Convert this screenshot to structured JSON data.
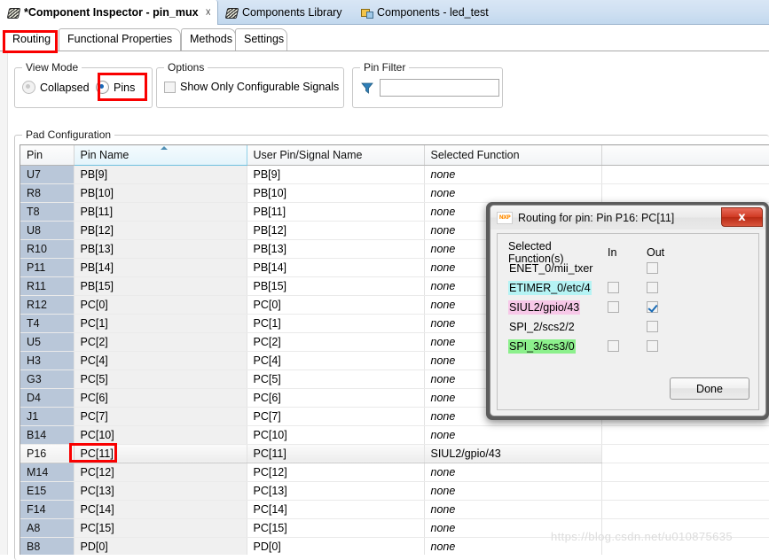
{
  "editor_tabs": [
    {
      "label": "*Component Inspector - pin_mux",
      "icon": "wedge-icon",
      "active": true,
      "closable": true
    },
    {
      "label": "Components Library",
      "icon": "wedge-icon",
      "active": false,
      "closable": false
    },
    {
      "label": "Components - led_test",
      "icon": "components-icon",
      "active": false,
      "closable": false
    }
  ],
  "inner_tabs": [
    {
      "label": "Routing",
      "selected": true
    },
    {
      "label": "Functional Properties",
      "selected": false
    },
    {
      "label": "Methods",
      "selected": false
    },
    {
      "label": "Settings",
      "selected": false
    }
  ],
  "view_mode": {
    "title": "View Mode",
    "options": [
      {
        "label": "Collapsed",
        "selected": false
      },
      {
        "label": "Pins",
        "selected": true
      }
    ]
  },
  "options": {
    "title": "Options",
    "checkbox_label": "Show Only Configurable Signals",
    "checked": false
  },
  "pin_filter": {
    "title": "Pin Filter",
    "icon": "filter-icon",
    "value": "",
    "placeholder": ""
  },
  "pad_configuration": {
    "title": "Pad Configuration",
    "columns": [
      "Pin",
      "Pin Name",
      "User Pin/Signal Name",
      "Selected Function",
      ""
    ],
    "sorted_column": "Pin Name",
    "sort_direction": "ascending",
    "rows": [
      {
        "pin": "U7",
        "pin_name": "PB[9]",
        "user": "PB[9]",
        "func": "none",
        "selected": false
      },
      {
        "pin": "R8",
        "pin_name": "PB[10]",
        "user": "PB[10]",
        "func": "none",
        "selected": false
      },
      {
        "pin": "T8",
        "pin_name": "PB[11]",
        "user": "PB[11]",
        "func": "none",
        "selected": false
      },
      {
        "pin": "U8",
        "pin_name": "PB[12]",
        "user": "PB[12]",
        "func": "none",
        "selected": false
      },
      {
        "pin": "R10",
        "pin_name": "PB[13]",
        "user": "PB[13]",
        "func": "none",
        "selected": false
      },
      {
        "pin": "P11",
        "pin_name": "PB[14]",
        "user": "PB[14]",
        "func": "none",
        "selected": false
      },
      {
        "pin": "R11",
        "pin_name": "PB[15]",
        "user": "PB[15]",
        "func": "none",
        "selected": false
      },
      {
        "pin": "R12",
        "pin_name": "PC[0]",
        "user": "PC[0]",
        "func": "none",
        "selected": false
      },
      {
        "pin": "T4",
        "pin_name": "PC[1]",
        "user": "PC[1]",
        "func": "none",
        "selected": false
      },
      {
        "pin": "U5",
        "pin_name": "PC[2]",
        "user": "PC[2]",
        "func": "none",
        "selected": false
      },
      {
        "pin": "H3",
        "pin_name": "PC[4]",
        "user": "PC[4]",
        "func": "none",
        "selected": false
      },
      {
        "pin": "G3",
        "pin_name": "PC[5]",
        "user": "PC[5]",
        "func": "none",
        "selected": false
      },
      {
        "pin": "D4",
        "pin_name": "PC[6]",
        "user": "PC[6]",
        "func": "none",
        "selected": false
      },
      {
        "pin": "J1",
        "pin_name": "PC[7]",
        "user": "PC[7]",
        "func": "none",
        "selected": false
      },
      {
        "pin": "B14",
        "pin_name": "PC[10]",
        "user": "PC[10]",
        "func": "none",
        "selected": false
      },
      {
        "pin": "P16",
        "pin_name": "PC[11]",
        "user": "PC[11]",
        "func": "SIUL2/gpio/43",
        "selected": true
      },
      {
        "pin": "M14",
        "pin_name": "PC[12]",
        "user": "PC[12]",
        "func": "none",
        "selected": false
      },
      {
        "pin": "E15",
        "pin_name": "PC[13]",
        "user": "PC[13]",
        "func": "none",
        "selected": false
      },
      {
        "pin": "F14",
        "pin_name": "PC[14]",
        "user": "PC[14]",
        "func": "none",
        "selected": false
      },
      {
        "pin": "A8",
        "pin_name": "PC[15]",
        "user": "PC[15]",
        "func": "none",
        "selected": false
      },
      {
        "pin": "B8",
        "pin_name": "PD[0]",
        "user": "PD[0]",
        "func": "none",
        "selected": false
      }
    ]
  },
  "dialog": {
    "title": "Routing for pin: Pin P16: PC[11]",
    "logo": "nxp-logo",
    "close_label": "x",
    "headers": {
      "function": "Selected Function(s)",
      "in": "In",
      "out": "Out"
    },
    "functions": [
      {
        "name": "ENET_0/mii_txer",
        "highlight": "none",
        "has_in": false,
        "in_checked": false,
        "has_out": true,
        "out_checked": false
      },
      {
        "name": "ETIMER_0/etc/4",
        "highlight": "cyan",
        "has_in": true,
        "in_checked": false,
        "has_out": true,
        "out_checked": false
      },
      {
        "name": "SIUL2/gpio/43",
        "highlight": "pink",
        "has_in": true,
        "in_checked": false,
        "has_out": true,
        "out_checked": true
      },
      {
        "name": "SPI_2/scs2/2",
        "highlight": "none",
        "has_in": false,
        "in_checked": false,
        "has_out": true,
        "out_checked": false
      },
      {
        "name": "SPI_3/scs3/0",
        "highlight": "green",
        "has_in": true,
        "in_checked": false,
        "has_out": true,
        "out_checked": false
      }
    ],
    "done_label": "Done"
  },
  "annotations": {
    "highlight_color": "#f90000",
    "boxes": [
      "routing-tab",
      "pins-radio",
      "pin-name-cell-pc11",
      "siul2-gpio-43-row"
    ]
  },
  "watermark": {
    "text": "https://blog.csdn.net/u010875635"
  },
  "colors": {
    "highlight_cyan": "#b5f3f4",
    "highlight_pink": "#f7c8e8",
    "highlight_green": "#8cf08c",
    "pin_column_bg": "#b9c7d9",
    "accent_red": "#f90000"
  }
}
